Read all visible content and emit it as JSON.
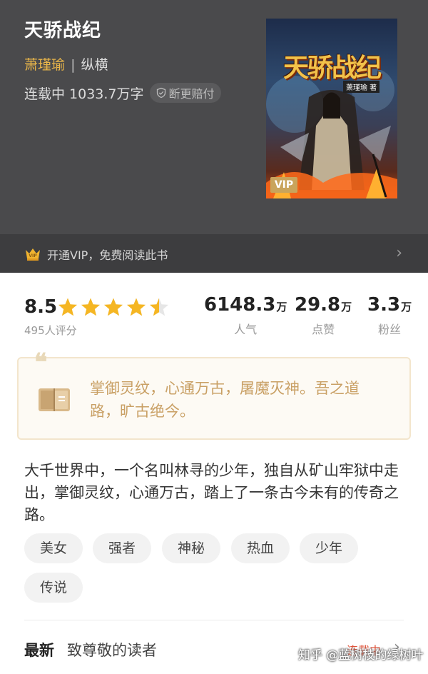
{
  "book": {
    "title": "天骄战纪",
    "author": "萧瑾瑜",
    "separator": "|",
    "category": "纵横",
    "status_words": "连载中 1033.7万字",
    "guarantee": "断更赔付"
  },
  "cover": {
    "title": "天骄战纪",
    "author_tag": "萧瑾瑜 著",
    "vip_tag": "VIP"
  },
  "vip_bar": {
    "text": "开通VIP，免费阅读此书",
    "arrow": "›"
  },
  "stats": {
    "rating": "8.5",
    "rating_stars": 4.5,
    "rating_count": "495人评分",
    "popularity": {
      "value": "6148.3",
      "unit": "万",
      "label": "人气"
    },
    "likes": {
      "value": "29.8",
      "unit": "万",
      "label": "点赞"
    },
    "fans": {
      "value": "3.3",
      "unit": "万",
      "label": "粉丝"
    }
  },
  "quote": {
    "mark": "❝",
    "text": "掌御灵纹，心通万古，屠魔灭神。吾之道路，旷古绝今。"
  },
  "synopsis": "大千世界中，一个名叫林寻的少年，独自从矿山牢狱中走出，掌御灵纹，心通万古，踏上了一条古今未有的传奇之路。",
  "tags": [
    "美女",
    "强者",
    "神秘",
    "热血",
    "少年",
    "传说"
  ],
  "latest": {
    "label": "最新",
    "chapter": "致尊敬的读者",
    "status": "连载中",
    "arrow": "›"
  },
  "watermark": "知乎 @蓝树枝的绿树叶",
  "colors": {
    "header_bg": "#4a4a4c",
    "author": "#e8b54a",
    "star": "#f5b623",
    "quote_text": "#c9a065",
    "serializing": "#e0533a"
  }
}
